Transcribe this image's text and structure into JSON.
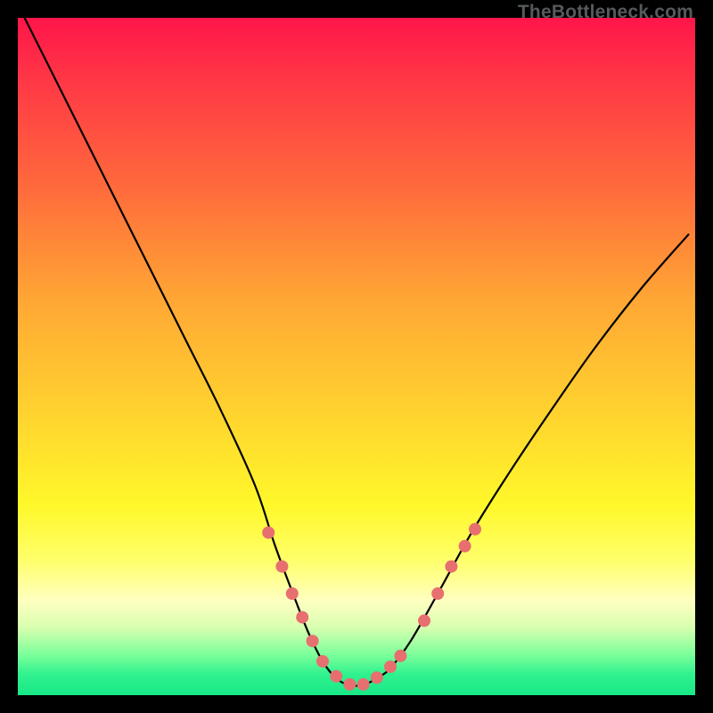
{
  "attribution": "TheBottleneck.com",
  "chart_data": {
    "type": "line",
    "title": "",
    "xlabel": "",
    "ylabel": "",
    "xlim": [
      0,
      100
    ],
    "ylim": [
      0,
      100
    ],
    "series": [
      {
        "name": "curve",
        "x": [
          1,
          5,
          10,
          15,
          20,
          25,
          30,
          35,
          38,
          41,
          43,
          45,
          47,
          49,
          51,
          53,
          55,
          58,
          62,
          67,
          72,
          78,
          85,
          92,
          99
        ],
        "values": [
          100,
          92,
          82,
          72,
          62,
          52,
          42,
          31,
          22,
          14,
          9,
          5,
          2.5,
          1.5,
          1.5,
          2.5,
          4,
          8,
          15,
          24,
          32,
          41,
          51,
          60,
          68
        ]
      }
    ],
    "markers": {
      "comment": "pink dots/dashes near the curve trough",
      "points": [
        {
          "x": 37,
          "y": 24
        },
        {
          "x": 39,
          "y": 19
        },
        {
          "x": 40.5,
          "y": 15
        },
        {
          "x": 42,
          "y": 11.5
        },
        {
          "x": 43.5,
          "y": 8
        },
        {
          "x": 45,
          "y": 5
        },
        {
          "x": 47,
          "y": 2.8
        },
        {
          "x": 49,
          "y": 1.6
        },
        {
          "x": 51,
          "y": 1.6
        },
        {
          "x": 53,
          "y": 2.6
        },
        {
          "x": 55,
          "y": 4.2
        },
        {
          "x": 56.5,
          "y": 5.8
        },
        {
          "x": 60,
          "y": 11
        },
        {
          "x": 62,
          "y": 15
        },
        {
          "x": 64,
          "y": 19
        },
        {
          "x": 66,
          "y": 22
        },
        {
          "x": 67.5,
          "y": 24.5
        }
      ],
      "color": "#e76f6f",
      "radius_px": 7
    },
    "gradient_stops": [
      {
        "pos": 0.0,
        "color": "#ff154a"
      },
      {
        "pos": 0.1,
        "color": "#ff3a45"
      },
      {
        "pos": 0.25,
        "color": "#ff6a3c"
      },
      {
        "pos": 0.42,
        "color": "#ffa834"
      },
      {
        "pos": 0.58,
        "color": "#ffd22f"
      },
      {
        "pos": 0.72,
        "color": "#fff82a"
      },
      {
        "pos": 0.8,
        "color": "#ffff6a"
      },
      {
        "pos": 0.86,
        "color": "#ffffc0"
      },
      {
        "pos": 0.9,
        "color": "#d8ffb0"
      },
      {
        "pos": 0.94,
        "color": "#7cff9a"
      },
      {
        "pos": 0.97,
        "color": "#2ef28e"
      },
      {
        "pos": 1.0,
        "color": "#19e888"
      }
    ]
  }
}
